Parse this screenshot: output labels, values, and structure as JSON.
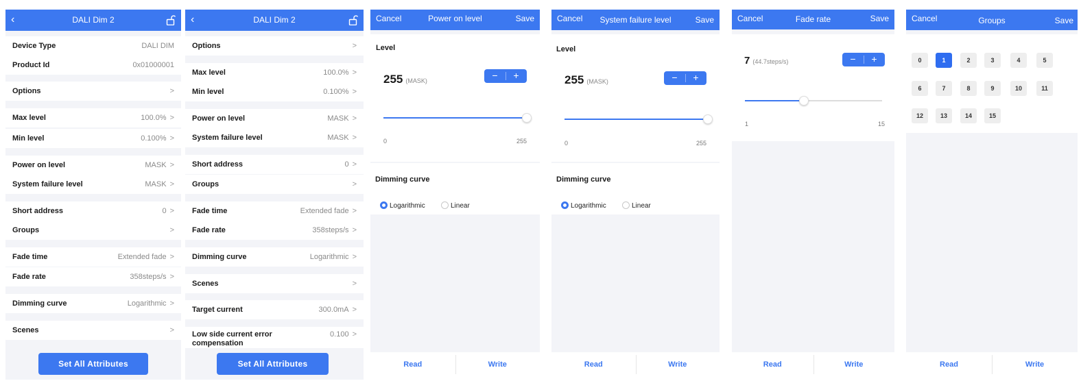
{
  "colors": {
    "accent": "#3c78f0",
    "background": "#f3f4f8"
  },
  "screen1": {
    "title": "DALI Dim 2",
    "back_icon": "chevron-left-icon",
    "lock_icon": "unlock-icon",
    "chevron": ">",
    "rows": [
      {
        "label": "Device Type",
        "value": "DALI DIM"
      },
      {
        "label": "Product Id",
        "value": "0x01000001"
      },
      {
        "label": "Options",
        "value": ""
      },
      {
        "label": "Max level",
        "value": "100.0%"
      },
      {
        "label": "Min level",
        "value": "0.100%"
      },
      {
        "label": "Power on level",
        "value": "MASK"
      },
      {
        "label": "System failure level",
        "value": "MASK"
      },
      {
        "label": "Short address",
        "value": "0"
      },
      {
        "label": "Groups",
        "value": ""
      },
      {
        "label": "Fade time",
        "value": "Extended fade"
      },
      {
        "label": "Fade rate",
        "value": "358steps/s"
      },
      {
        "label": "Dimming curve",
        "value": "Logarithmic"
      },
      {
        "label": "Scenes",
        "value": ""
      }
    ],
    "button": "Set All Attributes"
  },
  "screen2": {
    "title": "DALI Dim 2",
    "back_icon": "chevron-left-icon",
    "lock_icon": "unlock-icon",
    "chevron": ">",
    "rows": [
      {
        "label": "Options",
        "value": ""
      },
      {
        "label": "Max level",
        "value": "100.0%"
      },
      {
        "label": "Min level",
        "value": "0.100%"
      },
      {
        "label": "Power on level",
        "value": "MASK"
      },
      {
        "label": "System failure level",
        "value": "MASK"
      },
      {
        "label": "Short address",
        "value": "0"
      },
      {
        "label": "Groups",
        "value": ""
      },
      {
        "label": "Fade time",
        "value": "Extended fade"
      },
      {
        "label": "Fade rate",
        "value": "358steps/s"
      },
      {
        "label": "Dimming curve",
        "value": "Logarithmic"
      },
      {
        "label": "Scenes",
        "value": ""
      },
      {
        "label": "Target current",
        "value": "300.0mA"
      },
      {
        "label": "Low side current error compensation",
        "value": "0.100"
      }
    ],
    "button": "Set All Attributes"
  },
  "screen3": {
    "cancel": "Cancel",
    "title": "Power on level",
    "save": "Save",
    "level_label": "Level",
    "value": "255",
    "value_note": "(MASK)",
    "minus": "−",
    "plus": "+",
    "slider": {
      "min_label": "0",
      "max_label": "255",
      "fraction": 1.0
    },
    "curve_label": "Dimming curve",
    "opt_log": "Logarithmic",
    "opt_lin": "Linear",
    "selected": "Logarithmic",
    "read": "Read",
    "write": "Write"
  },
  "screen4": {
    "cancel": "Cancel",
    "title": "System failure level",
    "save": "Save",
    "level_label": "Level",
    "value": "255",
    "value_note": "(MASK)",
    "minus": "−",
    "plus": "+",
    "slider": {
      "min_label": "0",
      "max_label": "255",
      "fraction": 1.0
    },
    "curve_label": "Dimming curve",
    "opt_log": "Logarithmic",
    "opt_lin": "Linear",
    "selected": "Logarithmic",
    "read": "Read",
    "write": "Write"
  },
  "screen5": {
    "cancel": "Cancel",
    "title": "Fade rate",
    "save": "Save",
    "value": "7",
    "value_note": "(44.7steps/s)",
    "minus": "−",
    "plus": "+",
    "slider": {
      "min_label": "1",
      "max_label": "15",
      "fraction": 0.43
    },
    "read": "Read",
    "write": "Write"
  },
  "screen6": {
    "cancel": "Cancel",
    "title": "Groups",
    "save": "Save",
    "groups": [
      "0",
      "1",
      "2",
      "3",
      "4",
      "5",
      "6",
      "7",
      "8",
      "9",
      "10",
      "11",
      "12",
      "13",
      "14",
      "15"
    ],
    "selected": [
      "1"
    ],
    "read": "Read",
    "write": "Write"
  }
}
